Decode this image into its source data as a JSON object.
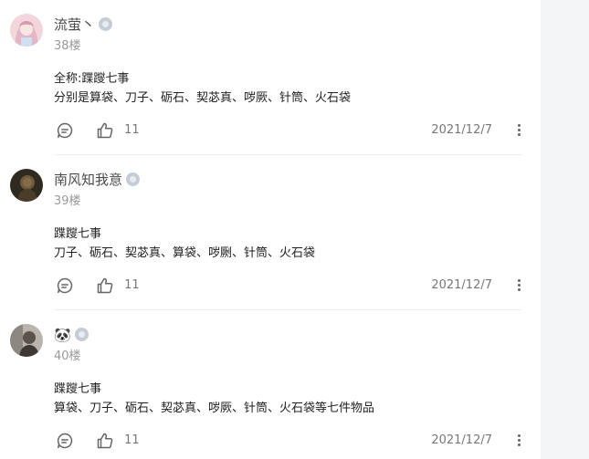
{
  "colors": {
    "text_primary": "#222222",
    "text_secondary": "#9a9a9a",
    "badge": "#c4ccd6",
    "divider": "#eeeeee",
    "sidebar_bg": "#f4f5f7"
  },
  "comments": [
    {
      "username": "流萤丶",
      "floor": "38楼",
      "lines": [
        "全称:蹀躞七事",
        "分别是算袋、刀子、砺石、契苾真、哕厥、针筒、火石袋"
      ],
      "likes": "11",
      "date": "2021/12/7",
      "avatar_icon": "anime-girl-avatar"
    },
    {
      "username": "南风知我意",
      "floor": "39楼",
      "lines": [
        "蹀躞七事",
        "刀子、砺石、契苾真、算袋、哕劂、针筒、火石袋"
      ],
      "likes": "11",
      "date": "2021/12/7",
      "avatar_icon": "dark-figure-avatar"
    },
    {
      "username": "🐼",
      "floor": "40楼",
      "lines": [
        "蹀躞七事",
        "算袋、刀子、砺石、契苾真、哕厥、针筒、火石袋等七件物品"
      ],
      "likes": "11",
      "date": "2021/12/7",
      "avatar_icon": "grey-portrait-avatar"
    }
  ]
}
